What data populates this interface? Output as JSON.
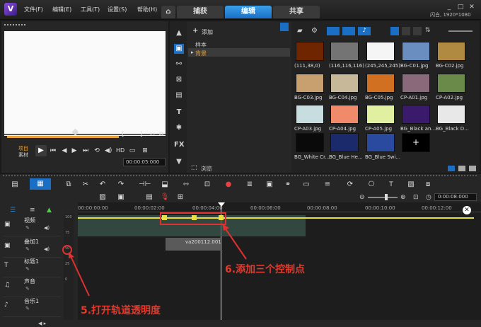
{
  "menu": {
    "file": "文件(F)",
    "edit": "编辑(E)",
    "tools": "工具(T)",
    "settings": "设置(S)",
    "help": "帮助(H)"
  },
  "tabs": {
    "capture": "捕获",
    "edit": "编辑",
    "share": "共享"
  },
  "status_right": "闪白, 1920*1080",
  "player": {
    "project_label": "项目",
    "clip_label": "素材",
    "hd_label": "HD",
    "timecode": "00:00:05:000"
  },
  "library": {
    "add_label": "添加",
    "folders": [
      "样本",
      "背景"
    ],
    "browse_label": "浏览",
    "items": [
      {
        "label": "(111,38,0)",
        "color": "#6f2600"
      },
      {
        "label": "(116,116,116)",
        "color": "#747474"
      },
      {
        "label": "(245,245,245)",
        "color": "#f5f5f5"
      },
      {
        "label": "BG-C01.jpg",
        "color": "#6a8ec0"
      },
      {
        "label": "BG-C02.jpg",
        "color": "#b08a40"
      },
      {
        "label": "BG-C03.jpg",
        "color": "#c8a070"
      },
      {
        "label": "BG-C04.jpg",
        "color": "#c8b89a"
      },
      {
        "label": "BG-C05.jpg",
        "color": "#d07020"
      },
      {
        "label": "CP-A01.jpg",
        "color": "#8a6a7a"
      },
      {
        "label": "CP-A02.jpg",
        "color": "#6a8a4a"
      },
      {
        "label": "CP-A03.jpg",
        "color": "#c8dde0"
      },
      {
        "label": "CP-A04.jpg",
        "color": "#f08a6a"
      },
      {
        "label": "CP-A05.jpg",
        "color": "#e0f0a0"
      },
      {
        "label": "BG_Black an...",
        "color": "#3a1a6a"
      },
      {
        "label": "BG_Black D...",
        "color": "#e8e8e8"
      },
      {
        "label": "BG_White Cr...",
        "color": "#0a0a0a"
      },
      {
        "label": "BG_Blue He...",
        "color": "#1a2a6a"
      },
      {
        "label": "BG_Blue Swi...",
        "color": "#2a4aa0"
      },
      {
        "label": "",
        "color": "#000000"
      }
    ]
  },
  "timeline": {
    "time_readout": "0:00:08:000",
    "ruler": [
      "00:00:00:00",
      "00:00:02:00",
      "00:00:04:00",
      "00:00:06:00",
      "00:00:08:00",
      "00:00:10:00",
      "00:00:12:00"
    ],
    "tracks": [
      "视频",
      "叠加1",
      "标题1",
      "声音",
      "音乐1"
    ],
    "scale": [
      "100",
      "75",
      "50",
      "25",
      "0"
    ],
    "clip_name": "va200112.001"
  },
  "annotations": {
    "step6": "6.添加三个控制点",
    "step5": "5.打开轨道透明度"
  }
}
